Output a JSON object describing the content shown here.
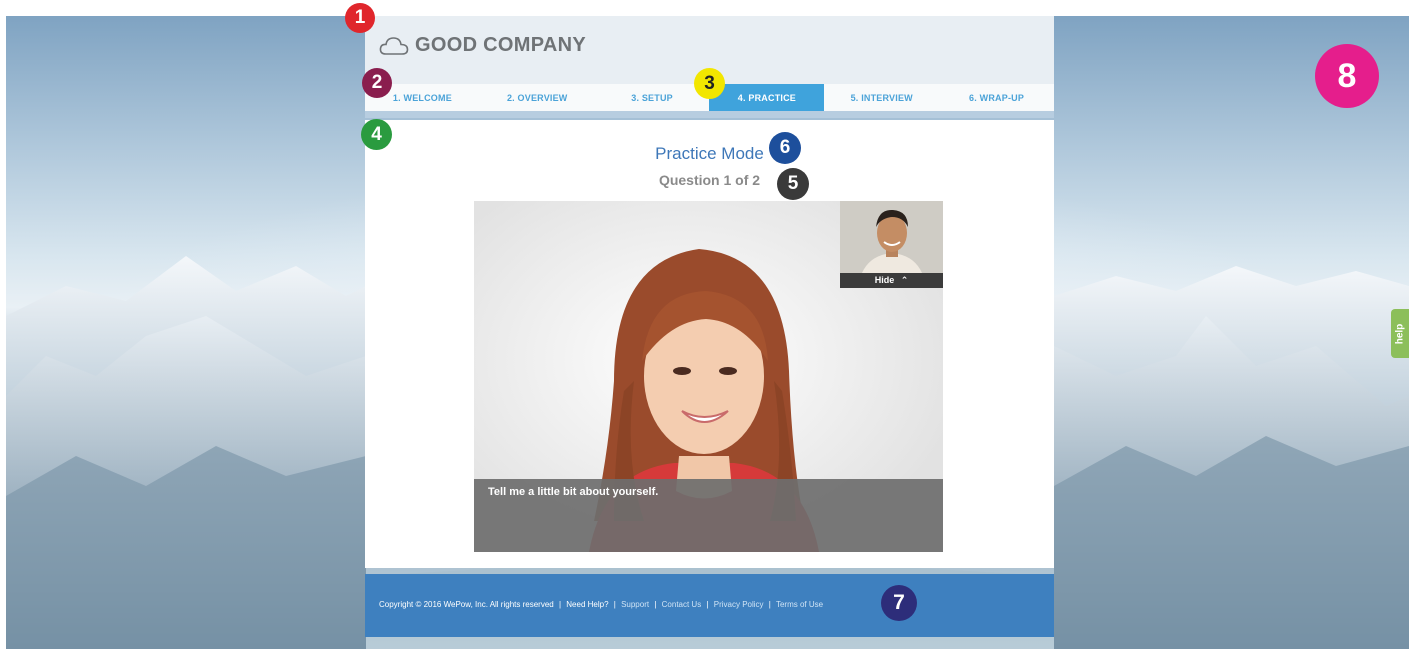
{
  "header": {
    "company_name": "GOOD COMPANY",
    "logo_icon": "cloud-icon"
  },
  "nav": {
    "items": [
      {
        "label": "1. WELCOME",
        "active": false
      },
      {
        "label": "2. OVERVIEW",
        "active": false
      },
      {
        "label": "3. SETUP",
        "active": false
      },
      {
        "label": "4. PRACTICE",
        "active": true
      },
      {
        "label": "5. INTERVIEW",
        "active": false
      },
      {
        "label": "6. WRAP-UP",
        "active": false
      }
    ]
  },
  "main": {
    "title": "Practice Mode",
    "question_counter": "Question 1 of 2",
    "video": {
      "caption": "Tell me a little bit about yourself.",
      "pip_hide_label": "Hide",
      "pip_hide_icon": "chevron-up-icon"
    }
  },
  "footer": {
    "copyright": "Copyright © 2016 WePow, Inc. All rights reserved",
    "need_help": "Need Help?",
    "links": [
      "Support",
      "Contact Us",
      "Privacy Policy",
      "Terms of Use"
    ]
  },
  "help_tab": {
    "label": "help"
  },
  "markers": [
    "1",
    "2",
    "3",
    "4",
    "5",
    "6",
    "7",
    "8"
  ],
  "colors": {
    "accent": "#3fa3dc",
    "title": "#3e77b8",
    "footer": "#3e80bf",
    "help": "#8cbf5a"
  }
}
